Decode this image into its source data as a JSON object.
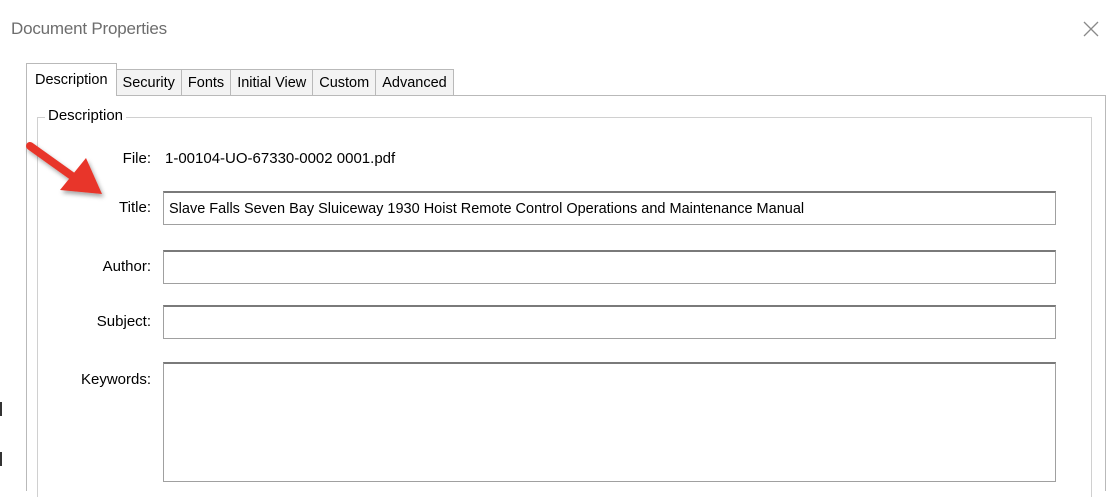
{
  "window": {
    "title": "Document Properties",
    "close_glyph": "╳"
  },
  "tabs": [
    {
      "label": "Description",
      "active": true
    },
    {
      "label": "Security",
      "active": false
    },
    {
      "label": "Fonts",
      "active": false
    },
    {
      "label": "Initial View",
      "active": false
    },
    {
      "label": "Custom",
      "active": false
    },
    {
      "label": "Advanced",
      "active": false
    }
  ],
  "description": {
    "group_label": "Description",
    "file_label": "File:",
    "file_value": "1-00104-UO-67330-0002 0001.pdf",
    "title_label": "Title:",
    "title_value": "Slave Falls Seven Bay Sluiceway 1930 Hoist Remote Control Operations and Maintenance Manual",
    "author_label": "Author:",
    "author_value": "",
    "subject_label": "Subject:",
    "subject_value": "",
    "keywords_label": "Keywords:",
    "keywords_value": ""
  },
  "annotation": {
    "arrow_icon": "red-arrow-icon",
    "arrow_color": "#e8362a"
  }
}
